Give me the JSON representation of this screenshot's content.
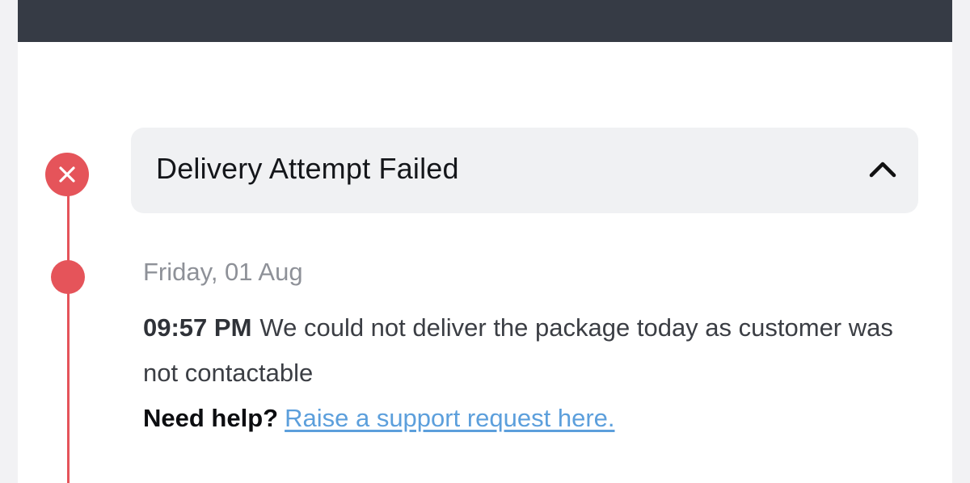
{
  "status": {
    "title": "Delivery Attempt Failed",
    "expanded": true,
    "icon": "close-icon",
    "toggle_icon": "chevron-up-icon"
  },
  "event": {
    "date": "Friday, 01 Aug",
    "time": "09:57 PM",
    "message": "We could not deliver the package today as customer was not contactable"
  },
  "help": {
    "label": "Need help?",
    "link_text": "Raise a support request here."
  },
  "colors": {
    "header_bar": "#363b45",
    "accent_red": "#e5545a",
    "link_blue": "#5c9fdc",
    "card_bg": "#f0f1f3"
  }
}
